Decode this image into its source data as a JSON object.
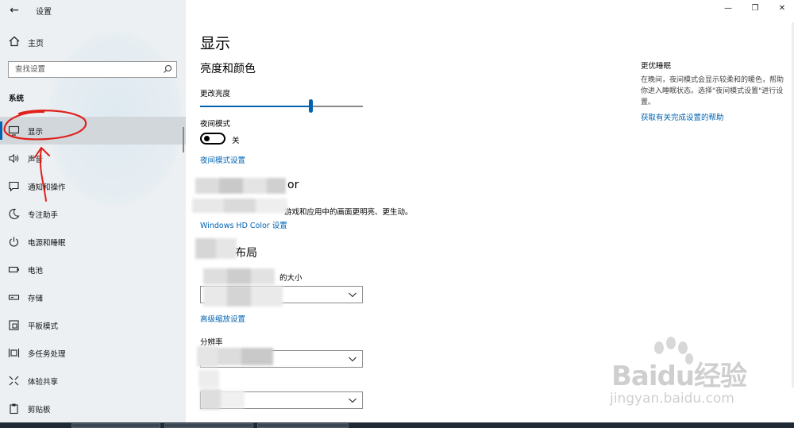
{
  "window": {
    "back_icon": "back-arrow-icon",
    "title": "设置",
    "minimize_glyph": "—",
    "maximize_glyph": "❐",
    "close_glyph": "✕"
  },
  "sidebar": {
    "home": {
      "label": "主页",
      "icon": "home-icon"
    },
    "search": {
      "placeholder": "查找设置",
      "icon": "search-icon"
    },
    "section_label": "系统",
    "items": [
      {
        "label": "显示",
        "icon": "monitor-icon",
        "active": true
      },
      {
        "label": "声音",
        "icon": "speaker-icon",
        "active": false
      },
      {
        "label": "通知和操作",
        "icon": "notification-icon",
        "active": false
      },
      {
        "label": "专注助手",
        "icon": "moon-icon",
        "active": false
      },
      {
        "label": "电源和睡眠",
        "icon": "power-icon",
        "active": false
      },
      {
        "label": "电池",
        "icon": "battery-icon",
        "active": false
      },
      {
        "label": "存储",
        "icon": "storage-icon",
        "active": false
      },
      {
        "label": "平板模式",
        "icon": "tablet-icon",
        "active": false
      },
      {
        "label": "多任务处理",
        "icon": "multitask-icon",
        "active": false
      },
      {
        "label": "体验共享",
        "icon": "share-icon",
        "active": false
      },
      {
        "label": "剪贴板",
        "icon": "clipboard-icon",
        "active": false
      }
    ]
  },
  "main": {
    "page_title": "显示",
    "brightness_section": {
      "heading": "亮度和颜色",
      "brightness_label": "更改亮度",
      "brightness_level": 0.68,
      "night_light_label": "夜间模式",
      "night_light_state": "关",
      "night_light_on": false,
      "night_light_settings_link": "夜间模式设置"
    },
    "hdr_section": {
      "heading_tail": "or",
      "description_tail": "游戏和应用中的画面更明亮、更生动。",
      "link": "Windows HD Color 设置"
    },
    "layout_section": {
      "heading_tail": "布局",
      "scale_label_tail": "的大小",
      "scale_value": "",
      "advanced_scaling_link": "高级缩放设置",
      "resolution_label": "分辨率",
      "resolution_value": "",
      "orientation_value": ""
    }
  },
  "right_panel": {
    "title": "更优睡眠",
    "description": "在晚间，夜间模式会显示较柔和的暖色，帮助你进入睡眠状态。选择\"夜间模式设置\"进行设置。",
    "link": "获取有关完成设置的帮助"
  },
  "watermark": {
    "brand": "Baidu经验",
    "url": "jingyan.baidu.com"
  },
  "colors": {
    "accent": "#0063b1",
    "sidebar_bg": "#ecf0f3",
    "annotation": "#e0201b"
  }
}
